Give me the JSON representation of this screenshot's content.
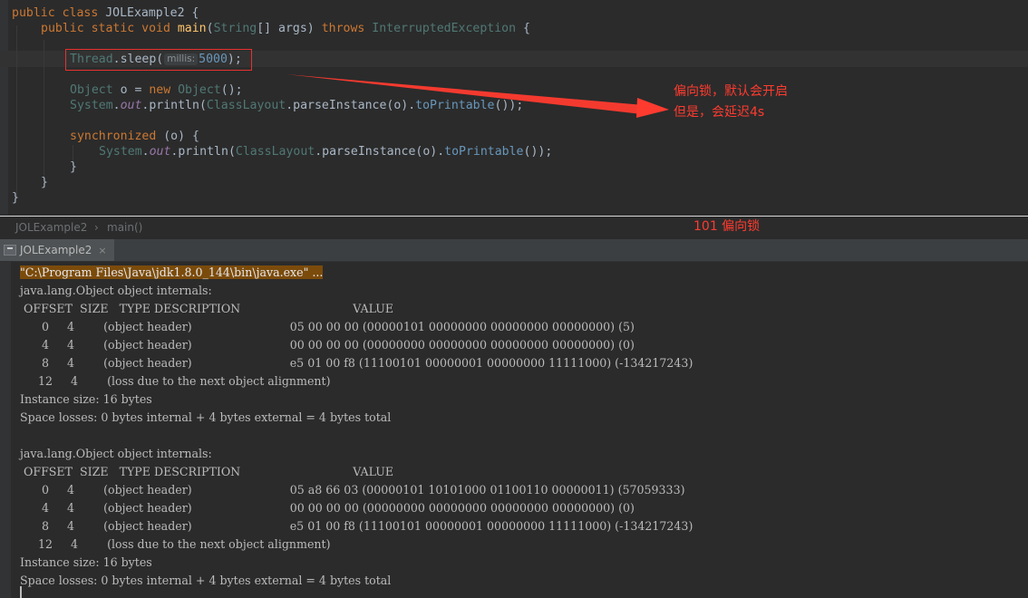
{
  "editor": {
    "lines": {
      "l0": "public class JOLExample2 {",
      "l1": "public static void main(String[] args) throws InterruptedException {",
      "l3_pre": "Thread.sleep(",
      "l3_hint": "millis:",
      "l3_num": "5000",
      "l3_post": ");",
      "l5": "Object o = new Object();",
      "l6": "System.out.println(ClassLayout.parseInstance(o).toPrintable());",
      "l8": "synchronized (o) {",
      "l9": "System.out.println(ClassLayout.parseInstance(o).toPrintable());",
      "l10": "}",
      "l11": "}",
      "l12": "}"
    }
  },
  "annotations": {
    "line1": "偏向锁，默认会开启",
    "line2": "但是，会延迟4s",
    "bits_note": "101 偏向锁"
  },
  "breadcrumb": {
    "class_name": "JOLExample2",
    "separator": "›",
    "method": "main()"
  },
  "run_tab": {
    "label": "JOLExample2",
    "close": "×"
  },
  "console": {
    "lines": [
      "\"C:\\Program Files\\Java\\jdk1.8.0_144\\bin\\java.exe\" ...",
      "java.lang.Object object internals:",
      " OFFSET  SIZE   TYPE DESCRIPTION                               VALUE",
      "      0     4        (object header)                           05 00 00 00 (00000101 00000000 00000000 00000000) (5)",
      "      4     4        (object header)                           00 00 00 00 (00000000 00000000 00000000 00000000) (0)",
      "      8     4        (object header)                           e5 01 00 f8 (11100101 00000001 00000000 11111000) (-134217243)",
      "     12     4        (loss due to the next object alignment)",
      "Instance size: 16 bytes",
      "Space losses: 0 bytes internal + 4 bytes external = 4 bytes total",
      "",
      "java.lang.Object object internals:",
      " OFFSET  SIZE   TYPE DESCRIPTION                               VALUE",
      "      0     4        (object header)                           05 a8 66 03 (00000101 10101000 01100110 00000011) (57059333)",
      "      4     4        (object header)                           00 00 00 00 (00000000 00000000 00000000 00000000) (0)",
      "      8     4        (object header)                           e5 01 00 f8 (11100101 00000001 00000000 11111000) (-134217243)",
      "     12     4        (loss due to the next object alignment)",
      "Instance size: 16 bytes",
      "Space losses: 0 bytes internal + 4 bytes external = 4 bytes total"
    ]
  },
  "colors": {
    "annotation": "#ff3b2f",
    "editor_bg": "#2b2b2b",
    "keyword": "#cc7832",
    "method": "#ffc66d",
    "number": "#6897bb"
  }
}
